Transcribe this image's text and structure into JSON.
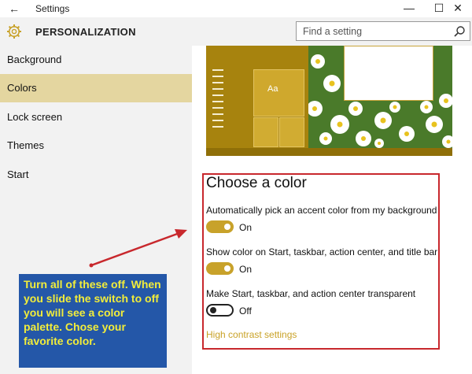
{
  "window": {
    "title": "Settings",
    "back_glyph": "←",
    "minimize_glyph": "—",
    "maximize_glyph": "☐",
    "close_glyph": "✕"
  },
  "header": {
    "app_title": "PERSONALIZATION",
    "search_placeholder": "Find a setting",
    "icon": "gear-icon",
    "accent_color": "#c8a22a"
  },
  "sidebar": {
    "items": [
      {
        "label": "Background",
        "active": false
      },
      {
        "label": "Colors",
        "active": true
      },
      {
        "label": "Lock screen",
        "active": false
      },
      {
        "label": "Themes",
        "active": false
      },
      {
        "label": "Start",
        "active": false
      }
    ]
  },
  "preview": {
    "tile_label": "Aa"
  },
  "colors_section": {
    "title": "Choose a color",
    "settings": [
      {
        "label": "Automatically pick an accent color from my background",
        "state": "On"
      },
      {
        "label": "Show color on Start, taskbar, action center, and title bar",
        "state": "On"
      },
      {
        "label": "Make Start, taskbar, and action center transparent",
        "state": "Off"
      }
    ],
    "link": "High contrast settings"
  },
  "annotation": {
    "text": "Turn all of these off. When you slide the switch to off you will see a color palette. Chose your favorite color.",
    "box_color": "#2457a8",
    "text_color": "#f2ed3a",
    "highlight_color": "#c8282d"
  }
}
